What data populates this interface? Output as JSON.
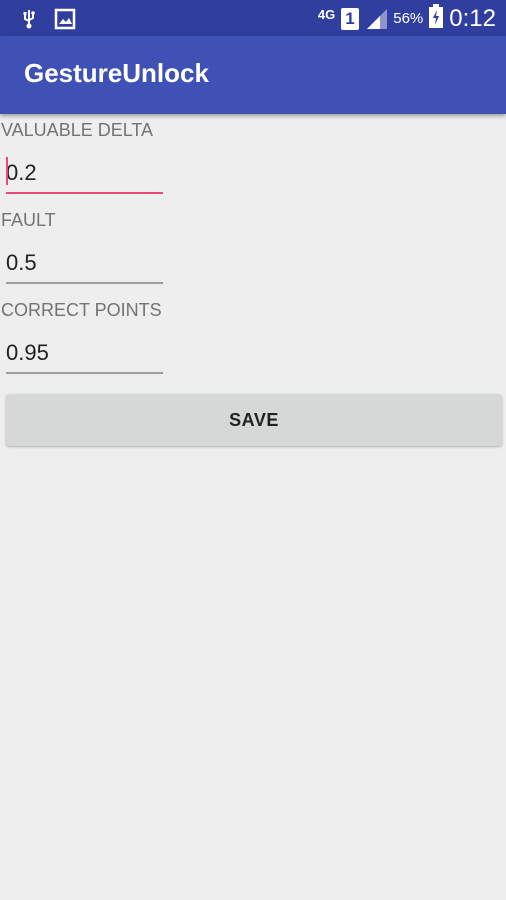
{
  "status_bar": {
    "usb_icon": "usb-icon",
    "image_icon": "image-notification-icon",
    "network": "4G",
    "sim_slot": "1",
    "signal_icon": "signal-icon",
    "battery_percent": "56%",
    "battery_icon": "battery-charging-icon",
    "time": "0:12"
  },
  "app_bar": {
    "title": "GestureUnlock"
  },
  "form": {
    "valuable_delta": {
      "label": "VALUABLE DELTA",
      "value": "0.2"
    },
    "fault": {
      "label": "FAULT",
      "value": "0.5"
    },
    "correct_points": {
      "label": "CORRECT POINTS",
      "value": "0.95"
    },
    "save_label": "SAVE"
  },
  "colors": {
    "status_bar": "#303f9f",
    "app_bar": "#3f51b5",
    "accent": "#e84a79",
    "background": "#eeeeee",
    "button": "#d6d7d7"
  }
}
